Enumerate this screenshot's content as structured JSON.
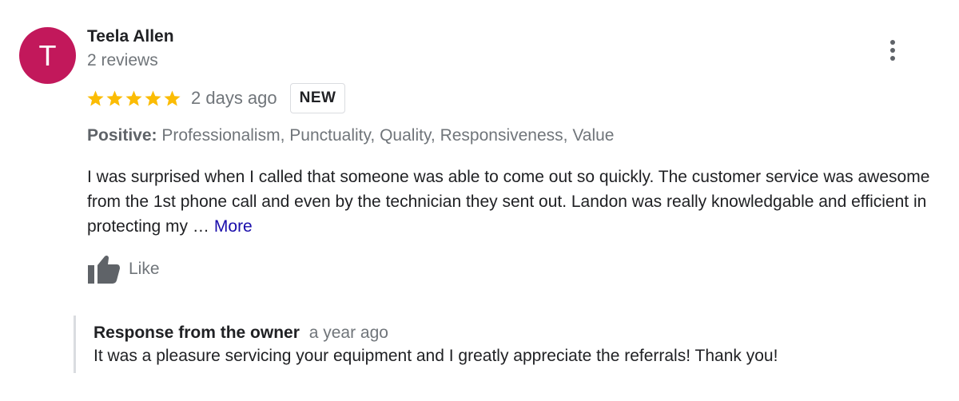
{
  "review": {
    "avatar_letter": "T",
    "avatar_color": "#c2185b",
    "reviewer_name": "Teela Allen",
    "review_count": "2 reviews",
    "rating": 5,
    "rating_max": 5,
    "star_color": "#fbbc04",
    "date": "2 days ago",
    "badge": "NEW",
    "highlights_label": "Positive:",
    "highlights_value": "Professionalism, Punctuality, Quality, Responsiveness, Value",
    "text": "I was surprised when I called that someone was able to come out so quickly. The customer service was awesome from the 1st phone call and even by the technician they sent out. Landon was really knowledgable and efficient in protecting my …",
    "more_label": "More",
    "more_color": "#1a0dab",
    "like_label": "Like",
    "menu_icon": "more-vert-icon"
  },
  "owner_response": {
    "title": "Response from the owner",
    "time": "a year ago",
    "text": "It was a pleasure servicing your equipment and I greatly appreciate the referrals! Thank you!"
  }
}
